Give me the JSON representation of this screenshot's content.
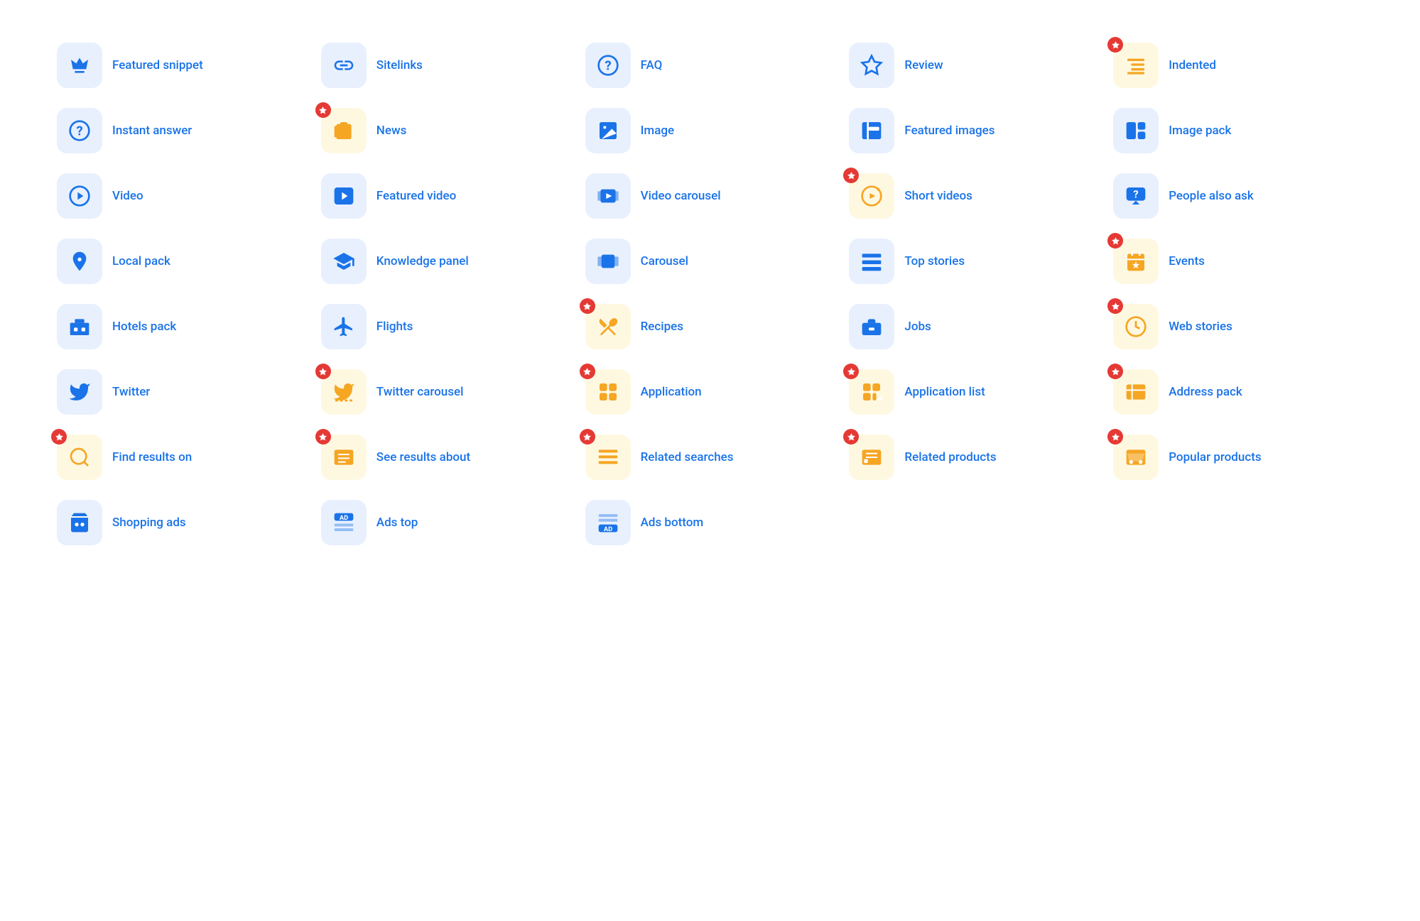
{
  "items": [
    {
      "id": "featured-snippet",
      "label": "Featured snippet",
      "bg": "blue-bg",
      "icon": "crown",
      "star": false
    },
    {
      "id": "sitelinks",
      "label": "Sitelinks",
      "bg": "blue-bg",
      "icon": "link",
      "star": false
    },
    {
      "id": "faq",
      "label": "FAQ",
      "bg": "blue-bg",
      "icon": "question-circle",
      "star": false
    },
    {
      "id": "review",
      "label": "Review",
      "bg": "blue-bg",
      "icon": "star-outline",
      "star": false
    },
    {
      "id": "indented",
      "label": "Indented",
      "bg": "yellow-bg",
      "icon": "indent",
      "star": true
    },
    {
      "id": "instant-answer",
      "label": "Instant answer",
      "bg": "blue-bg",
      "icon": "question-circle",
      "star": false
    },
    {
      "id": "news",
      "label": "News",
      "bg": "yellow-bg",
      "icon": "newspaper",
      "star": true
    },
    {
      "id": "image",
      "label": "Image",
      "bg": "blue-bg",
      "icon": "image",
      "star": false
    },
    {
      "id": "featured-images",
      "label": "Featured images",
      "bg": "blue-bg",
      "icon": "featured-image",
      "star": false
    },
    {
      "id": "image-pack",
      "label": "Image pack",
      "bg": "blue-bg",
      "icon": "image-pack",
      "star": false
    },
    {
      "id": "video",
      "label": "Video",
      "bg": "blue-bg",
      "icon": "play-circle",
      "star": false
    },
    {
      "id": "featured-video",
      "label": "Featured video",
      "bg": "blue-bg",
      "icon": "play-square",
      "star": false
    },
    {
      "id": "video-carousel",
      "label": "Video carousel",
      "bg": "blue-bg",
      "icon": "video-carousel",
      "star": false
    },
    {
      "id": "short-videos",
      "label": "Short videos",
      "bg": "yellow-bg",
      "icon": "short-video",
      "star": true
    },
    {
      "id": "people-also-ask",
      "label": "People also ask",
      "bg": "blue-bg",
      "icon": "people-ask",
      "star": false
    },
    {
      "id": "local-pack",
      "label": "Local pack",
      "bg": "blue-bg",
      "icon": "location",
      "star": false
    },
    {
      "id": "knowledge-panel",
      "label": "Knowledge panel",
      "bg": "blue-bg",
      "icon": "knowledge",
      "star": false
    },
    {
      "id": "carousel",
      "label": "Carousel",
      "bg": "blue-bg",
      "icon": "carousel",
      "star": false
    },
    {
      "id": "top-stories",
      "label": "Top stories",
      "bg": "blue-bg",
      "icon": "top-stories",
      "star": false
    },
    {
      "id": "events",
      "label": "Events",
      "bg": "yellow-bg",
      "icon": "events",
      "star": true
    },
    {
      "id": "hotels-pack",
      "label": "Hotels pack",
      "bg": "blue-bg",
      "icon": "hotel",
      "star": false
    },
    {
      "id": "flights",
      "label": "Flights",
      "bg": "blue-bg",
      "icon": "flights",
      "star": false
    },
    {
      "id": "recipes",
      "label": "Recipes",
      "bg": "yellow-bg",
      "icon": "recipes",
      "star": true
    },
    {
      "id": "jobs",
      "label": "Jobs",
      "bg": "blue-bg",
      "icon": "jobs",
      "star": false
    },
    {
      "id": "web-stories",
      "label": "Web stories",
      "bg": "yellow-bg",
      "icon": "web-stories",
      "star": true
    },
    {
      "id": "twitter",
      "label": "Twitter",
      "bg": "blue-bg",
      "icon": "twitter",
      "star": false
    },
    {
      "id": "twitter-carousel",
      "label": "Twitter carousel",
      "bg": "yellow-bg",
      "icon": "twitter-carousel",
      "star": true
    },
    {
      "id": "application",
      "label": "Application",
      "bg": "yellow-bg",
      "icon": "application",
      "star": true
    },
    {
      "id": "application-list",
      "label": "Application list",
      "bg": "yellow-bg",
      "icon": "application-list",
      "star": true
    },
    {
      "id": "address-pack",
      "label": "Address pack",
      "bg": "yellow-bg",
      "icon": "address-pack",
      "star": true
    },
    {
      "id": "find-results-on",
      "label": "Find results on",
      "bg": "yellow-bg",
      "icon": "find-results",
      "star": true
    },
    {
      "id": "see-results-about",
      "label": "See results about",
      "bg": "yellow-bg",
      "icon": "see-results",
      "star": true
    },
    {
      "id": "related-searches",
      "label": "Related searches",
      "bg": "yellow-bg",
      "icon": "related-searches",
      "star": true
    },
    {
      "id": "related-products",
      "label": "Related products",
      "bg": "yellow-bg",
      "icon": "related-products",
      "star": true
    },
    {
      "id": "popular-products",
      "label": "Popular products",
      "bg": "yellow-bg",
      "icon": "popular-products",
      "star": true
    },
    {
      "id": "shopping-ads",
      "label": "Shopping ads",
      "bg": "blue-bg",
      "icon": "shopping-ads",
      "star": false
    },
    {
      "id": "ads-top",
      "label": "Ads top",
      "bg": "blue-bg",
      "icon": "ads-top",
      "star": false
    },
    {
      "id": "ads-bottom",
      "label": "Ads bottom",
      "bg": "blue-bg",
      "icon": "ads-bottom",
      "star": false
    }
  ]
}
